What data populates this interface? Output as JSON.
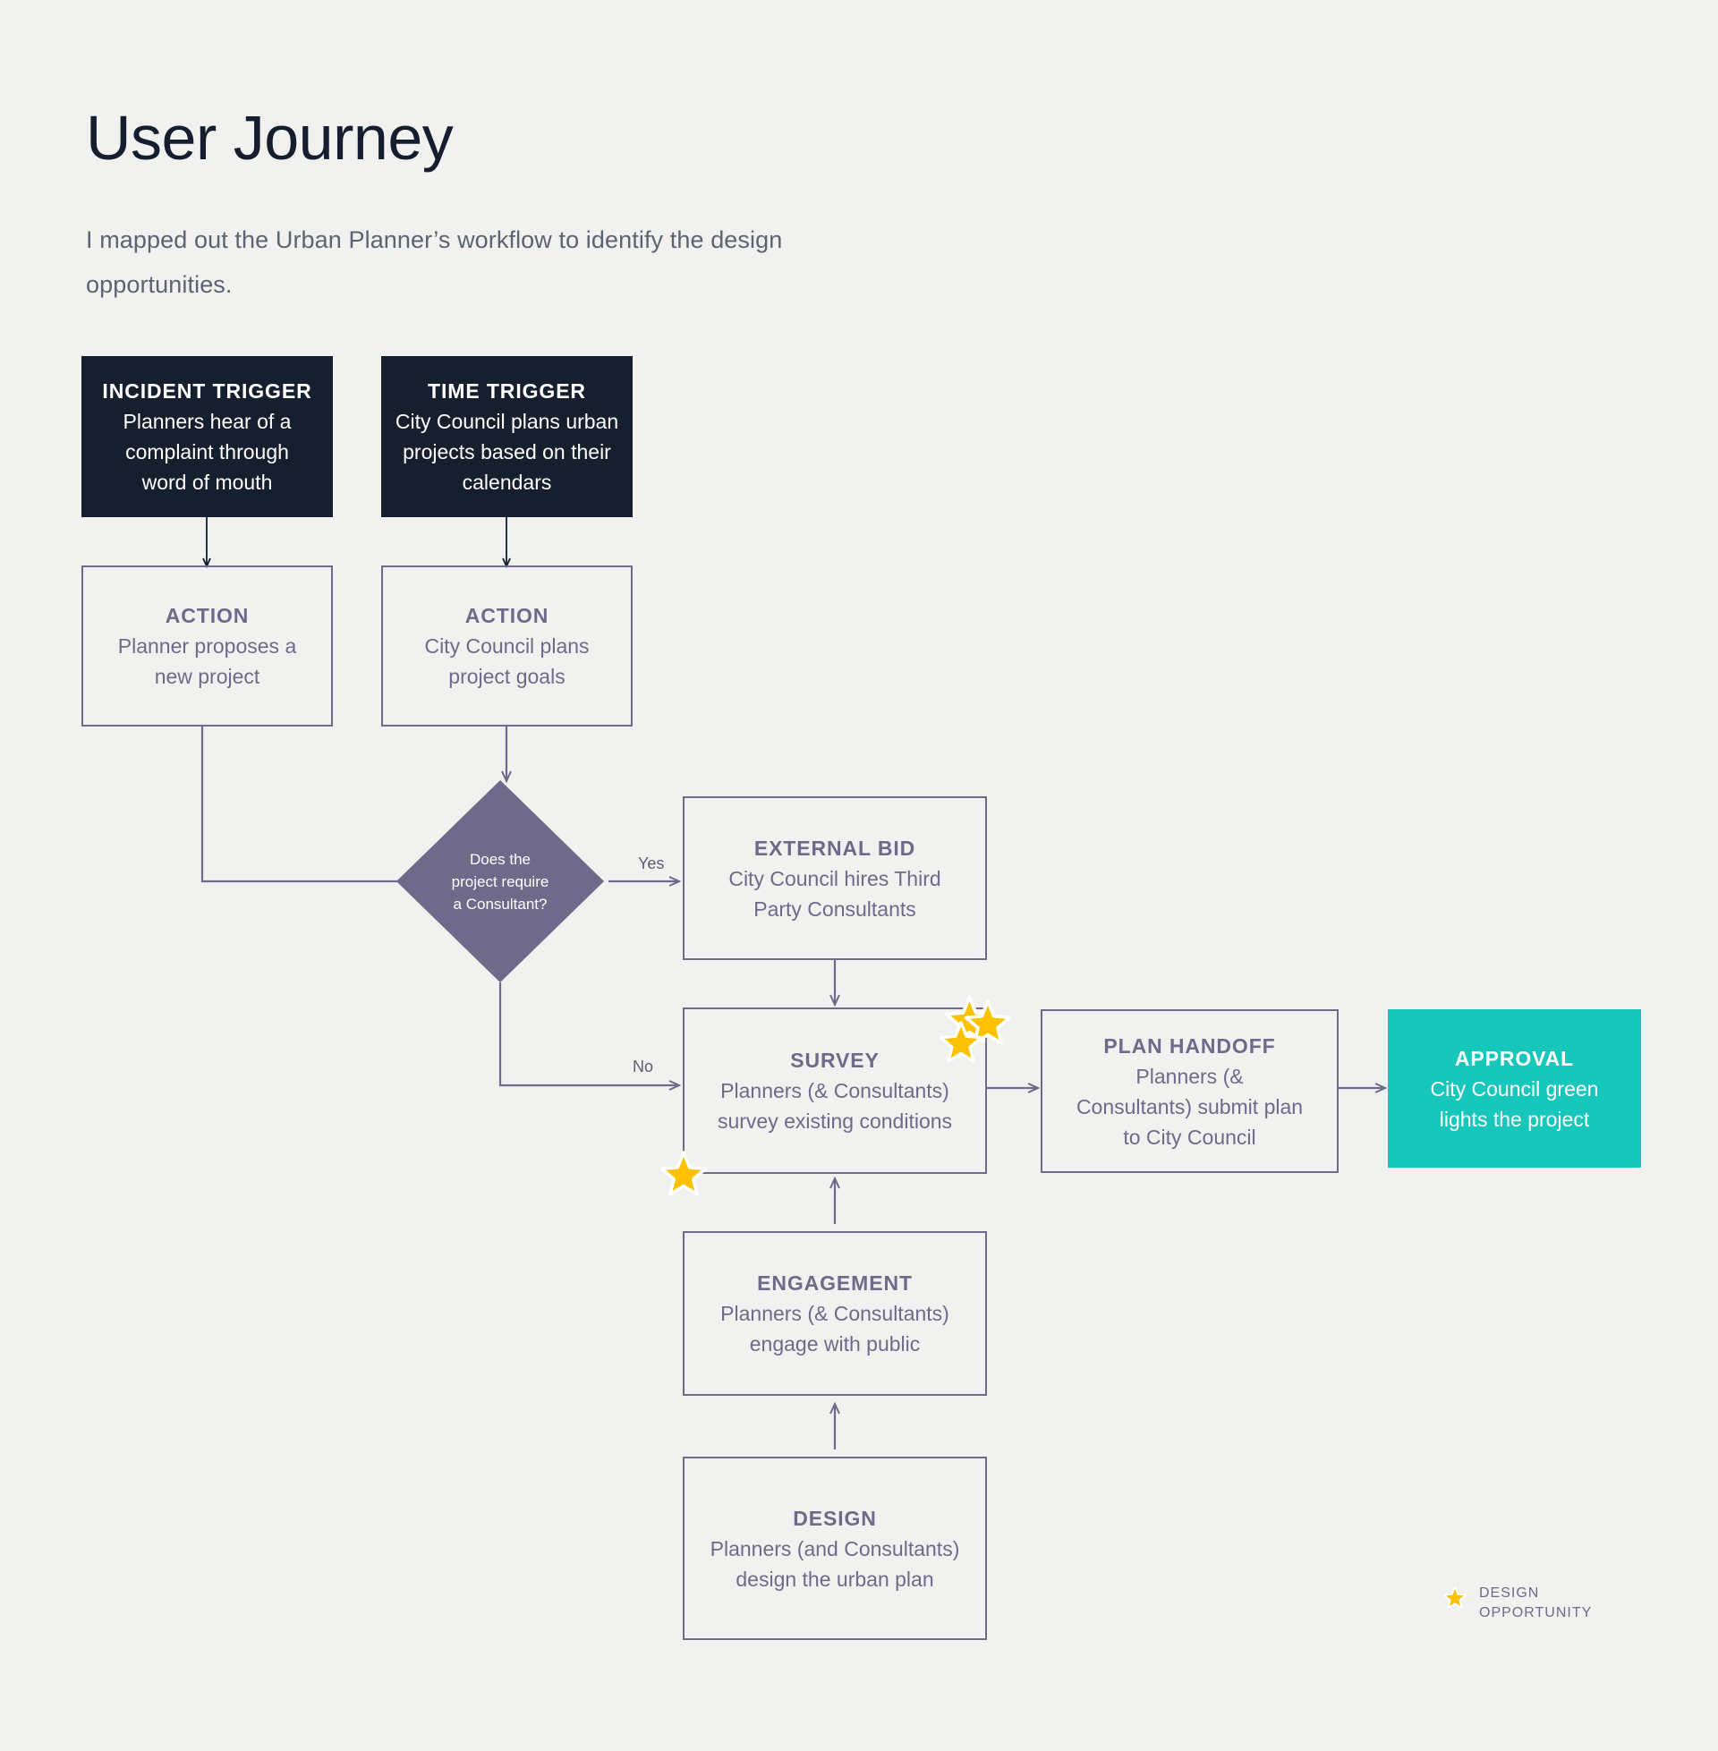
{
  "header": {
    "title": "User Journey",
    "subtitle": "I mapped out the Urban Planner’s workflow to identify the design opportunities."
  },
  "colors": {
    "background": "#f1f1f0",
    "dark_node": "#151f2e",
    "outline_node_border": "#6f6a8a",
    "diamond_fill": "#6f6a8a",
    "accent_node": "#17c7bb",
    "star": "#fcc200",
    "star_outline": "#ffffff",
    "title_text": "#141e2e",
    "subtitle_text": "#5b6470"
  },
  "nodes": {
    "incident_trigger": {
      "title": "INCIDENT TRIGGER",
      "desc": "Planners hear of a complaint through word of mouth"
    },
    "time_trigger": {
      "title": "TIME TRIGGER",
      "desc": "City Council plans urban projects based on their calendars"
    },
    "action_left": {
      "title": "ACTION",
      "desc": "Planner proposes a new project"
    },
    "action_right": {
      "title": "ACTION",
      "desc": "City Council plans project goals"
    },
    "decision": {
      "text": "Does the project require a Consultant?"
    },
    "external_bid": {
      "title": "EXTERNAL BID",
      "desc": "City Council hires Third Party Consultants"
    },
    "survey": {
      "title": "SURVEY",
      "desc": "Planners (& Consultants) survey existing conditions"
    },
    "plan_handoff": {
      "title": "PLAN HANDOFF",
      "desc": "Planners (& Consultants) submit plan to City Council"
    },
    "approval": {
      "title": "APPROVAL",
      "desc": "City Council green lights the project"
    },
    "engagement": {
      "title": "ENGAGEMENT",
      "desc": "Planners (& Consultants) engage with public"
    },
    "design": {
      "title": "DESIGN",
      "desc": "Planners (and Consultants) design the urban plan"
    }
  },
  "edge_labels": {
    "yes": "Yes",
    "no": "No"
  },
  "legend": {
    "label": "DESIGN\nOPPORTUNITY",
    "icon": "star-icon"
  },
  "markers": {
    "survey_top_right_stars": 3,
    "survey_bottom_left_stars": 1
  }
}
